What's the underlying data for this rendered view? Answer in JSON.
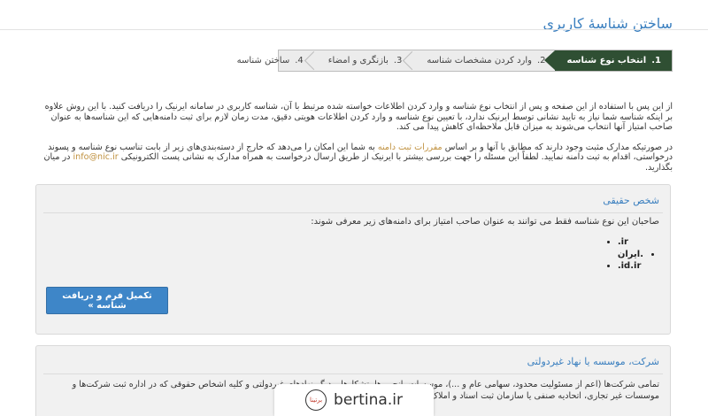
{
  "header": {
    "title": "ساختن شناسهٔ کاربری"
  },
  "steps": [
    {
      "num": "1.",
      "label": "انتخاب نوع شناسه",
      "active": true
    },
    {
      "num": "2.",
      "label": "وارد کردن مشخصات شناسه",
      "active": false
    },
    {
      "num": "3.",
      "label": "بازنگری و امضاء",
      "active": false
    },
    {
      "num": "4.",
      "label": "ساختن شناسه",
      "active": false
    }
  ],
  "intro": {
    "p1": "از این پس با استفاده از این صفحه و پس از انتخاب نوع شناسه و وارد کردن اطلاعات خواسته شده مرتبط با آن، شناسه کاربری در سامانه ایرنیک را دریافت کنید. با این روش علاوه بر اینکه شناسه شما نیاز به تایید نشانی توسط ایرنیک ندارد، با تعیین نوع شناسه و وارد کردن اطلاعات هویتی دقیق، مدت زمان لازم برای ثبت دامنه‌هایی که این شناسه‌ها به عنوان صاحب امتیاز آنها انتخاب می‌شوند به میزان قابل ملاحظه‌ای کاهش پیدا می کند.",
    "p2_a": "در صورتیکه مدارک مثبت وجود دارند که مطابق با آنها و بر اساس ",
    "p2_link": "مقررات ثبت دامنه",
    "p2_b": " به شما این امکان را می‌دهد که خارج از دسته‌بندی‌های زیر از بابت تناسب نوع شناسه و پسوند درخواستی، اقدام به ثبت دامنه نمایید. لطفاً این مسئله را جهت بررسی بیشتر با ایرنیک از طریق ارسال درخواست به همراه مدارک به نشانی پست الکترونیکی ",
    "p2_email": "info@nic.ir",
    "p2_c": " در میان بگذارید."
  },
  "panel_person": {
    "title": "شخص حقیقی",
    "desc": "صاحبان این نوع شناسه فقط می توانند به عنوان صاحب امتیاز برای دامنه‌های زیر معرفی شوند:",
    "tlds": [
      ".ir",
      ".ایران",
      ".id.ir"
    ],
    "button_label": "تکمیل فرم و دریافت شناسه »"
  },
  "panel_company": {
    "title": "شرکت، موسسه یا نهاد غیردولتی",
    "desc": "تمامی شرکت‌ها (اعم از مسئولیت محدود، سهامی عام و ...)، موسسات، انجمن‌ها، تشکل‌ها و دیگر نهادهای غیردولتی و کلیه اشخاص حقوقی که در اداره ثبت شرکت‌ها و موسسات غیر تجاری، اتحادیه صنفی یا سازمان ثبت اسناد و املاک کشور به ثبت رسیده‌اند."
  },
  "watermark": {
    "text": "bertina.ir",
    "logo_text": "برتینا"
  },
  "colors": {
    "accent": "#3a7fbf",
    "active_step": "#2f4f33",
    "button": "#3e86c8",
    "link": "#c0913f"
  }
}
